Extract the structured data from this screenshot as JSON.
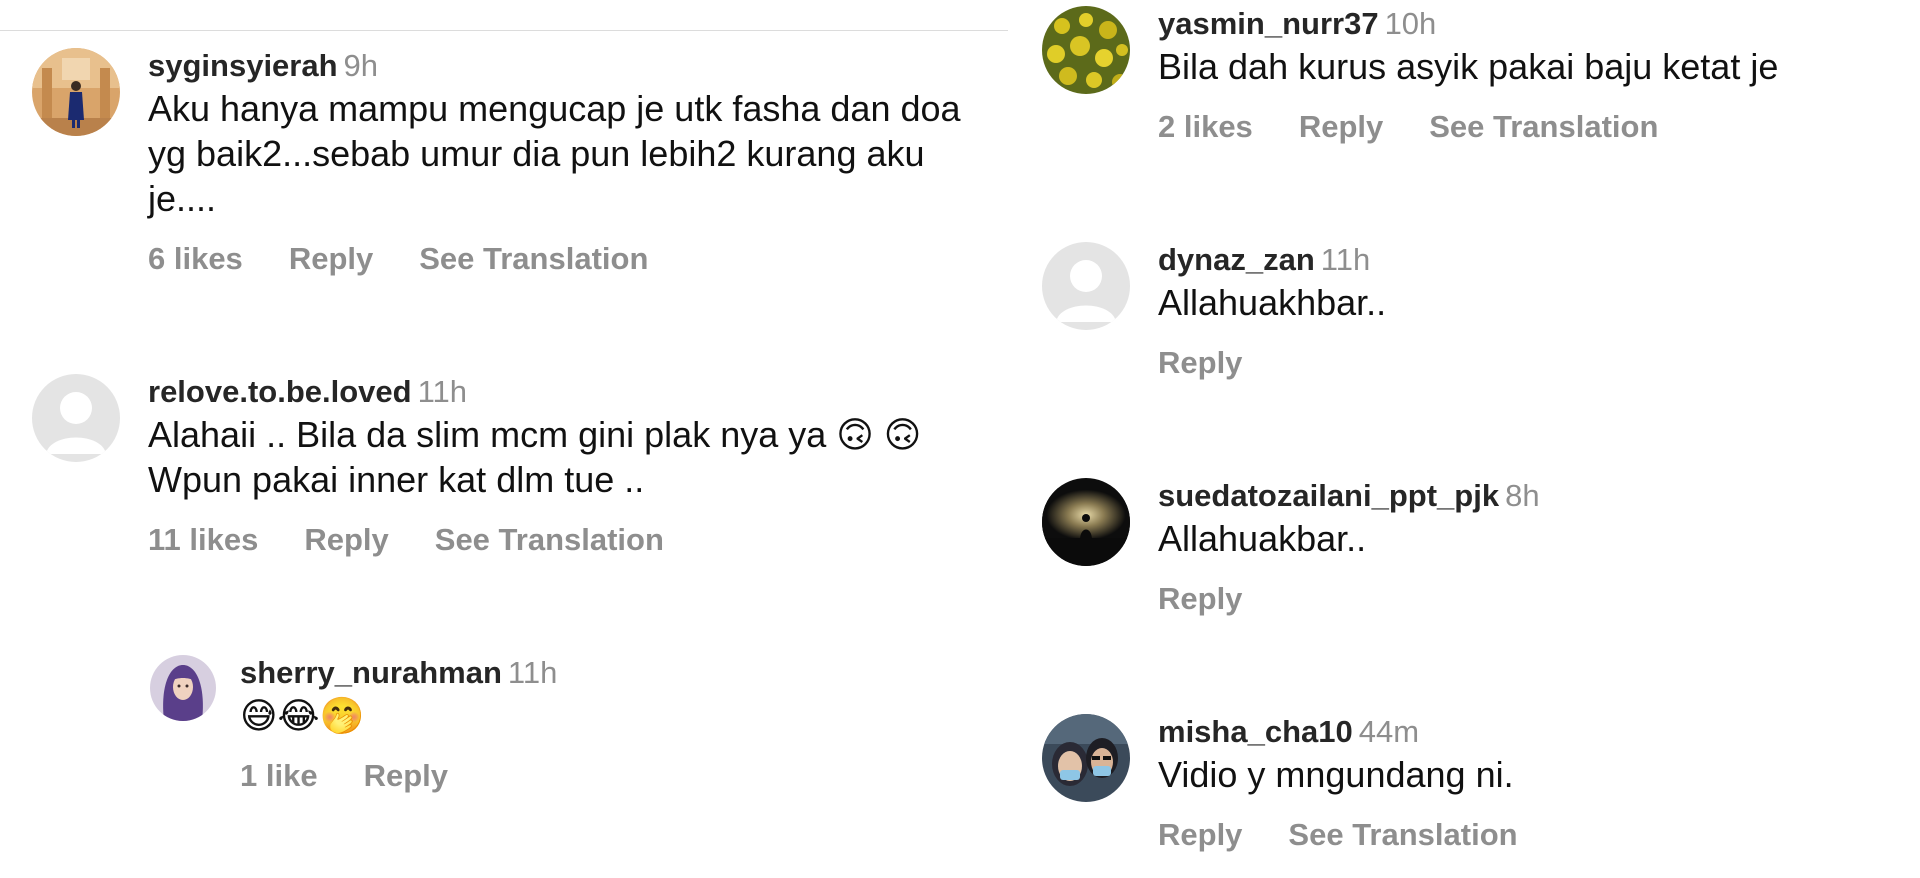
{
  "left_column": {
    "comments": [
      {
        "username": "syginsyierah",
        "time": "9h",
        "text": "Aku hanya mampu mengucap je utk fasha dan doa yg baik2...sebab umur dia pun lebih2 kurang aku je....",
        "likes": "6 likes",
        "reply": "Reply",
        "translate": "See Translation",
        "avatar_icon": "profile-photo-person-in-room"
      },
      {
        "username": "relove.to.be.loved",
        "time": "11h",
        "text": "Alahaii .. Bila da slim mcm gini plak nya ya 🙃 🙃 Wpun pakai inner kat dlm tue ..",
        "likes": "11 likes",
        "reply": "Reply",
        "translate": "See Translation",
        "avatar_icon": "default-avatar"
      },
      {
        "username": "sherry_nurahman",
        "time": "11h",
        "text": "😅😂🤭",
        "likes": "1 like",
        "reply": "Reply",
        "avatar_icon": "profile-photo-hijab-woman"
      }
    ]
  },
  "right_column": {
    "comments": [
      {
        "username": "yasmin_nurr37",
        "time": "10h",
        "text": "Bila dah kurus asyik pakai baju ketat je",
        "likes": "2 likes",
        "reply": "Reply",
        "translate": "See Translation",
        "avatar_icon": "profile-photo-yellow-flowers"
      },
      {
        "username": "dynaz_zan",
        "time": "11h",
        "text": "Allahuakhbar..",
        "reply": "Reply",
        "avatar_icon": "default-avatar"
      },
      {
        "username": "suedatozailani_ppt_pjk",
        "time": "8h",
        "text": "Allahuakbar..",
        "reply": "Reply",
        "avatar_icon": "profile-photo-sunset-silhouette"
      },
      {
        "username": "misha_cha10",
        "time": "44m",
        "text": "Vidio y mngundang ni.",
        "reply": "Reply",
        "translate": "See Translation",
        "avatar_icon": "profile-photo-couple-masks"
      }
    ]
  },
  "colors": {
    "username": "#262626",
    "meta_gray": "#8e8e8e",
    "text": "#111111",
    "divider": "#dcdcdc",
    "default_avatar_bg": "#e4e4e4"
  }
}
